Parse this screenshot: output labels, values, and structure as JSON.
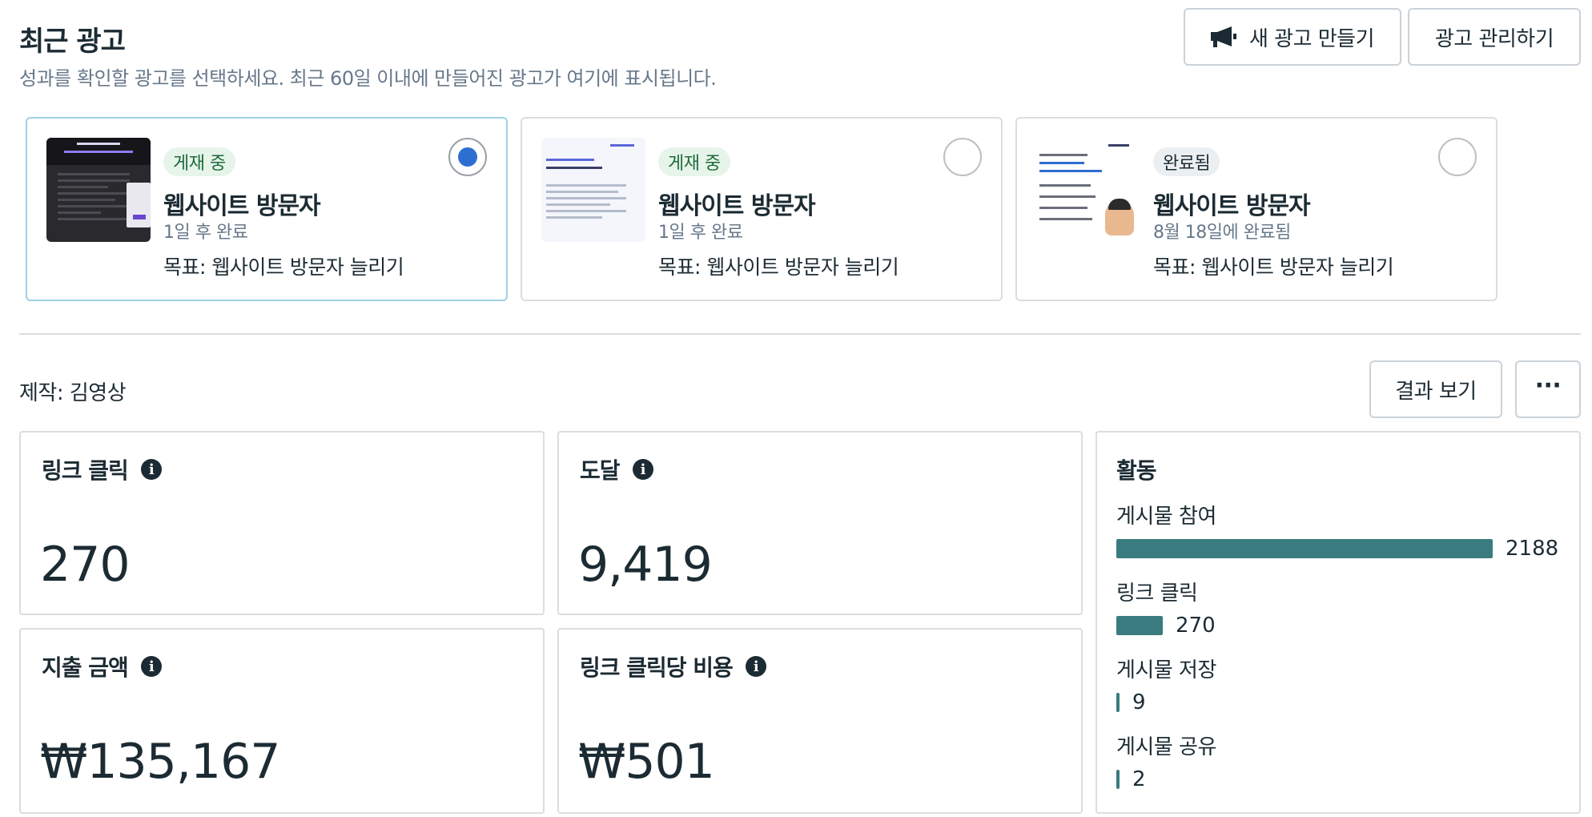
{
  "header": {
    "title": "최근 광고",
    "subtitle": "성과를 확인할 광고를 선택하세요. 최근 60일 이내에 만들어진 광고가 여기에 표시됩니다.",
    "new_ad_label": "새 광고 만들기",
    "manage_label": "광고 관리하기"
  },
  "ads": [
    {
      "status": "게재 중",
      "name": "웹사이트 방문자",
      "date": "1일 후 완료",
      "goal": "목표: 웹사이트 방문자 늘리기",
      "selected": true
    },
    {
      "status": "게재 중",
      "name": "웹사이트 방문자",
      "date": "1일 후 완료",
      "goal": "목표: 웹사이트 방문자 늘리기",
      "selected": false
    },
    {
      "status": "완료됨",
      "name": "웹사이트 방문자",
      "date": "8월 18일에 완료됨",
      "goal": "목표: 웹사이트 방문자 늘리기",
      "selected": false
    }
  ],
  "detail": {
    "creator": "제작: 김영상",
    "results_label": "결과 보기",
    "more_label": "···"
  },
  "metrics": {
    "link_clicks": {
      "title": "링크 클릭",
      "value": "270"
    },
    "reach": {
      "title": "도달",
      "value": "9,419"
    },
    "spend": {
      "title": "지출 금액",
      "value": "₩135,167"
    },
    "cpc": {
      "title": "링크 클릭당 비용",
      "value": "₩501"
    }
  },
  "activity": {
    "title": "활동",
    "max": 2188,
    "items": [
      {
        "label": "게시물 참여",
        "value": 2188
      },
      {
        "label": "링크 클릭",
        "value": 270
      },
      {
        "label": "게시물 저장",
        "value": 9
      },
      {
        "label": "게시물 공유",
        "value": 2
      }
    ]
  },
  "colors": {
    "accent": "#2d6fd0",
    "bar": "#3a7b7f",
    "live_badge": "#e6f4ea"
  }
}
